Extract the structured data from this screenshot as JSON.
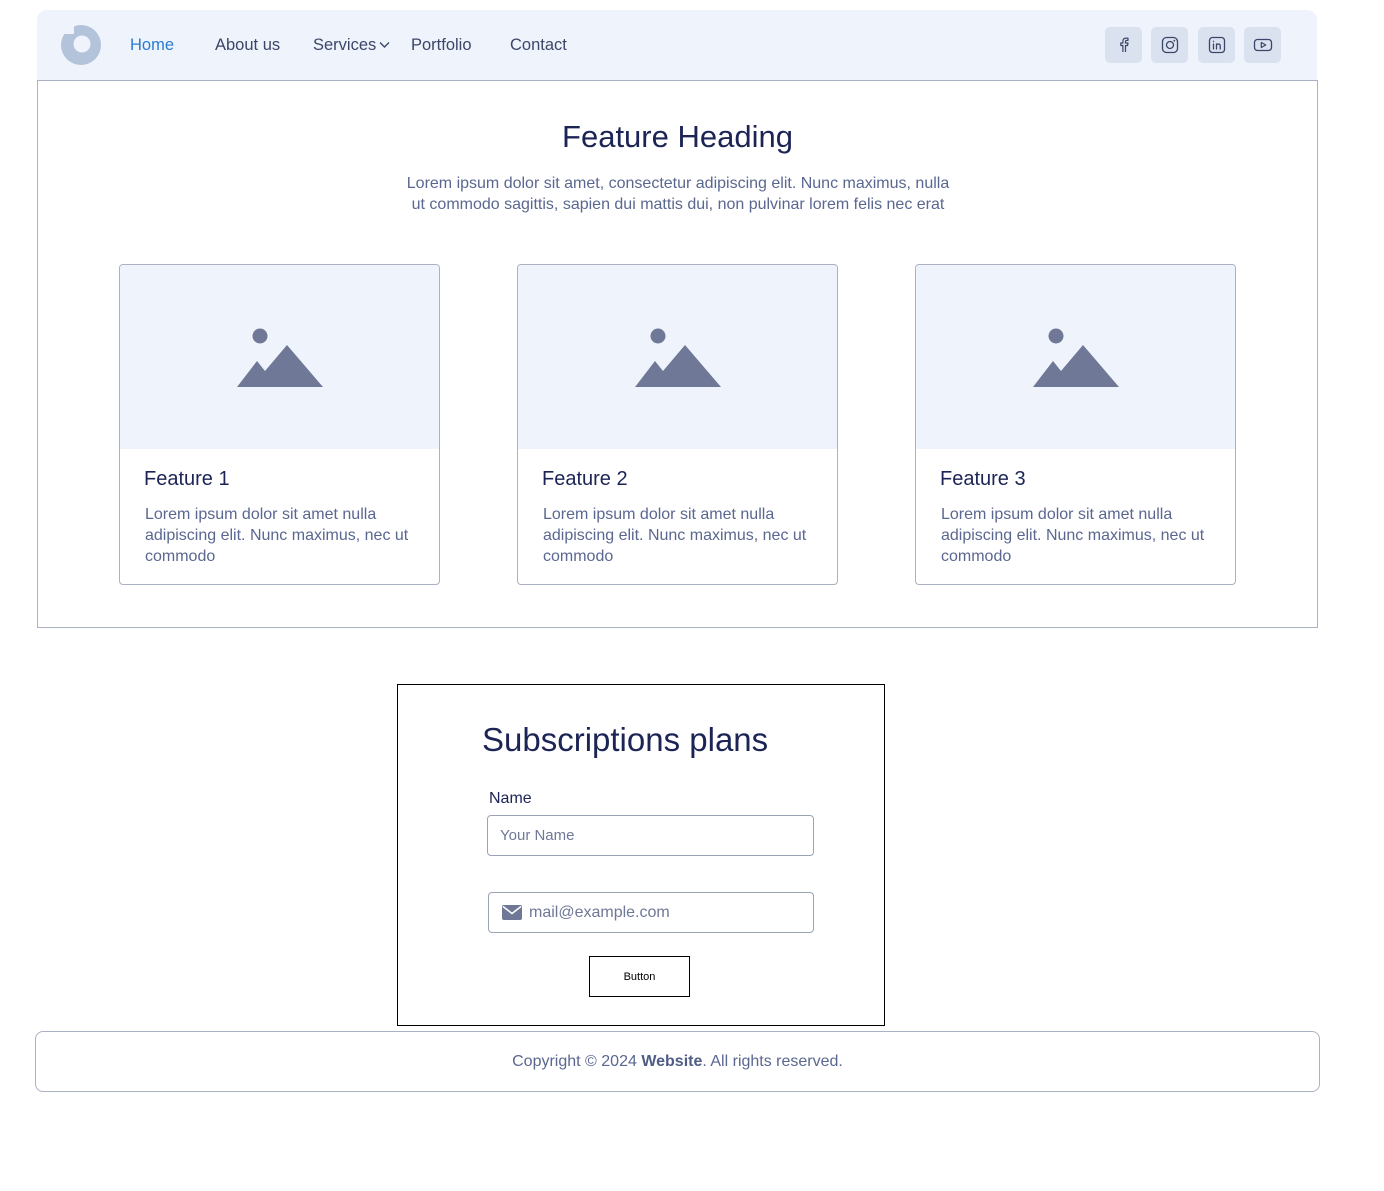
{
  "header": {
    "nav": [
      {
        "label": "Home",
        "active": true
      },
      {
        "label": "About us"
      },
      {
        "label": "Services",
        "has_dropdown": true
      },
      {
        "label": "Portfolio"
      },
      {
        "label": "Contact"
      }
    ],
    "social": [
      "facebook-icon",
      "instagram-icon",
      "linkedin-icon",
      "youtube-icon"
    ]
  },
  "features": {
    "heading": "Feature Heading",
    "subtitle": "Lorem ipsum dolor sit amet, consectetur adipiscing elit. Nunc maximus, nulla ut commodo sagittis, sapien dui mattis dui, non pulvinar lorem felis nec erat",
    "cards": [
      {
        "title": "Feature 1",
        "text": "Lorem ipsum dolor sit amet nulla adipiscing elit. Nunc maximus, nec ut commodo"
      },
      {
        "title": "Feature 2",
        "text": "Lorem ipsum dolor sit amet nulla adipiscing elit. Nunc maximus, nec ut commodo"
      },
      {
        "title": "Feature 3",
        "text": "Lorem ipsum dolor sit amet nulla adipiscing elit. Nunc maximus, nec ut commodo"
      }
    ]
  },
  "subscription": {
    "title": "Subscriptions plans",
    "name_label": "Name",
    "name_placeholder": "Your Name",
    "email_placeholder": "mail@example.com",
    "button_label": "Button"
  },
  "footer": {
    "prefix": "Copyright © 2024 ",
    "brand": "Website",
    "suffix": ". All rights reserved."
  },
  "colors": {
    "accent": "#2a7bd4",
    "heading": "#1c2456",
    "muted": "#5a6790",
    "panel_bg": "#eff4fc",
    "icon_gray": "#6f7896"
  }
}
